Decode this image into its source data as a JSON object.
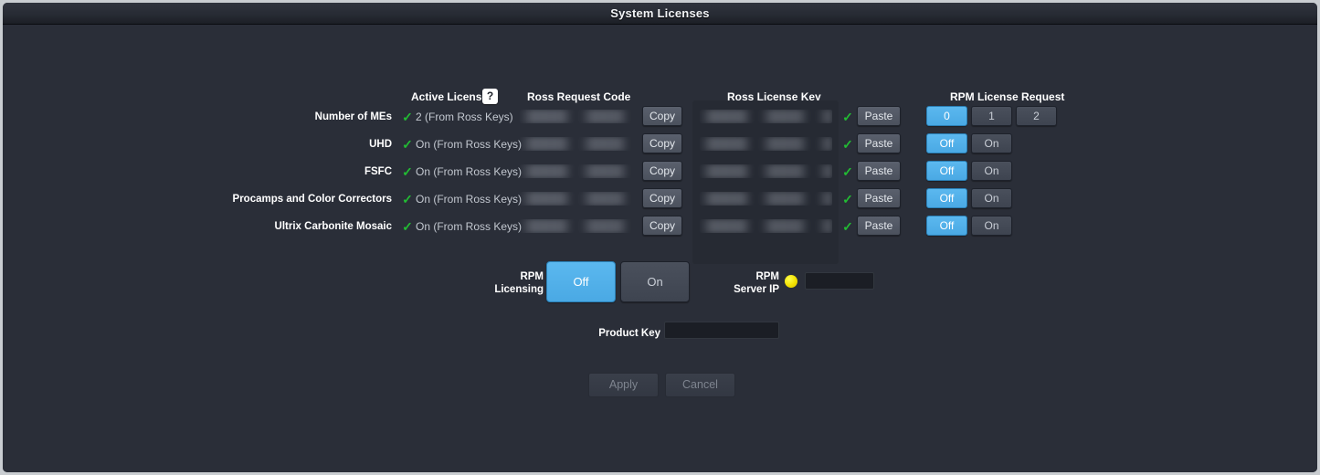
{
  "window": {
    "title": "System Licenses"
  },
  "headers": {
    "active_licenses": "Active Licenses",
    "help_icon": "?",
    "ross_request_code": "Ross Request Code",
    "ross_license_key": "Ross License Key",
    "rpm_license_request": "RPM License Request"
  },
  "colors": {
    "accent_blue": "#4aa9e4",
    "check_green": "#22bb33",
    "status_yellow": "#f2e000",
    "panel_bg": "#2a2e38",
    "titlebar_bg": "#272b34"
  },
  "rows": [
    {
      "label": "Number of MEs",
      "check": "✓",
      "active_value": "2 (From Ross Keys)",
      "request_code": "",
      "license_key": "",
      "copy_label": "Copy",
      "paste_label": "Paste",
      "paste_check": "✓",
      "options": [
        "0",
        "1",
        "2"
      ],
      "selected": "0"
    },
    {
      "label": "UHD",
      "check": "✓",
      "active_value": "On (From Ross Keys)",
      "request_code": "",
      "license_key": "",
      "copy_label": "Copy",
      "paste_label": "Paste",
      "paste_check": "✓",
      "options": [
        "Off",
        "On"
      ],
      "selected": "Off"
    },
    {
      "label": "FSFC",
      "check": "✓",
      "active_value": "On (From Ross Keys)",
      "request_code": "",
      "license_key": "",
      "copy_label": "Copy",
      "paste_label": "Paste",
      "paste_check": "✓",
      "options": [
        "Off",
        "On"
      ],
      "selected": "Off"
    },
    {
      "label": "Procamps and Color Correctors",
      "check": "✓",
      "active_value": "On (From Ross Keys)",
      "request_code": "",
      "license_key": "",
      "copy_label": "Copy",
      "paste_label": "Paste",
      "paste_check": "✓",
      "options": [
        "Off",
        "On"
      ],
      "selected": "Off"
    },
    {
      "label": "Ultrix Carbonite Mosaic",
      "check": "✓",
      "active_value": "On (From Ross Keys)",
      "request_code": "",
      "license_key": "",
      "copy_label": "Copy",
      "paste_label": "Paste",
      "paste_check": "✓",
      "options": [
        "Off",
        "On"
      ],
      "selected": "Off"
    }
  ],
  "rpm_licensing": {
    "label_line1": "RPM",
    "label_line2": "Licensing",
    "options": [
      "Off",
      "On"
    ],
    "selected": "Off"
  },
  "rpm_server_ip": {
    "label_line1": "RPM",
    "label_line2": "Server IP",
    "status_indicator": "yellow-status-dot",
    "value": "",
    "placeholder": ""
  },
  "product_key": {
    "label": "Product Key",
    "value": "",
    "placeholder": ""
  },
  "actions": {
    "apply": "Apply",
    "cancel": "Cancel"
  }
}
